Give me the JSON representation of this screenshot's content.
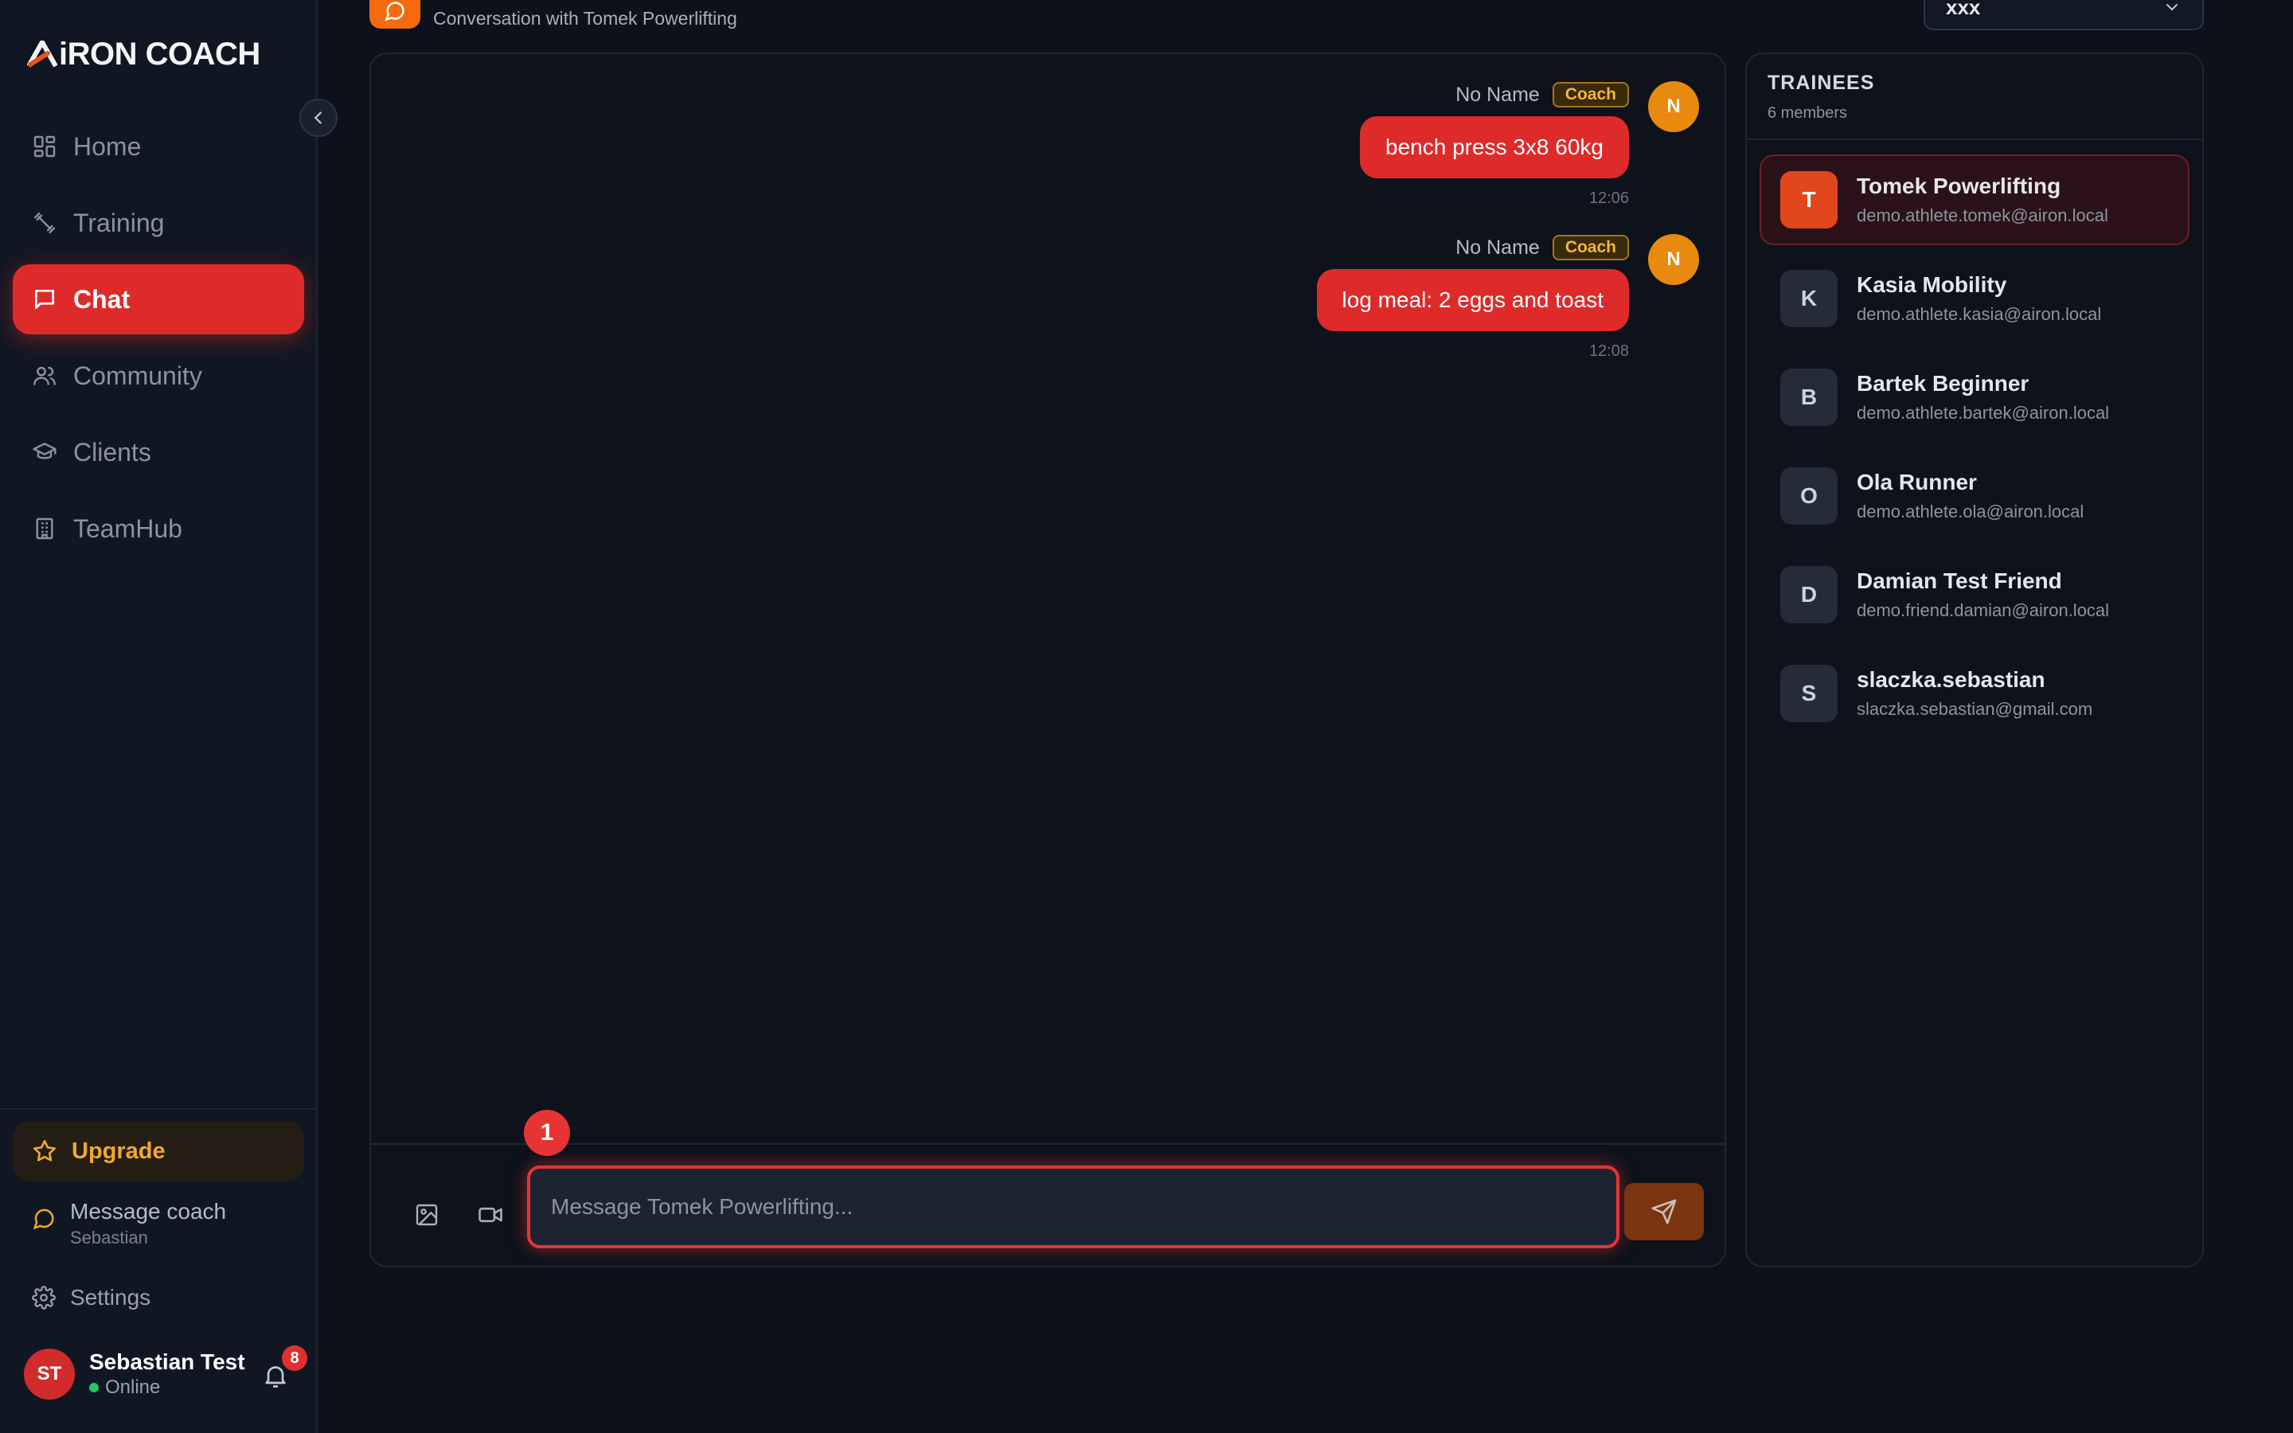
{
  "app": {
    "logo_a": "A",
    "logo_rest": "iRON COACH"
  },
  "sidebar": {
    "items": [
      {
        "label": "Home",
        "icon": "grid-icon"
      },
      {
        "label": "Training",
        "icon": "dumbbell-icon"
      },
      {
        "label": "Chat",
        "icon": "chat-icon",
        "active": true
      },
      {
        "label": "Community",
        "icon": "users-icon"
      },
      {
        "label": "Clients",
        "icon": "graduation-cap-icon"
      },
      {
        "label": "TeamHub",
        "icon": "building-icon"
      }
    ],
    "upgrade_label": "Upgrade",
    "message_coach_label": "Message coach",
    "message_coach_sub": "Sebastian",
    "settings_label": "Settings",
    "user": {
      "initials": "ST",
      "name": "Sebastian Test",
      "status": "Online",
      "notification_count": "8"
    }
  },
  "header": {
    "subtitle": "Conversation with Tomek Powerlifting",
    "select_value": "xxx"
  },
  "chat": {
    "messages": [
      {
        "sender": "No Name",
        "badge": "Coach",
        "avatar": "N",
        "text": "bench press 3x8 60kg",
        "time": "12:06"
      },
      {
        "sender": "No Name",
        "badge": "Coach",
        "avatar": "N",
        "text": "log meal: 2 eggs and toast",
        "time": "12:08"
      }
    ],
    "composer_placeholder": "Message Tomek Powerlifting...",
    "step_badge": "1"
  },
  "trainees": {
    "title": "TRAINEES",
    "count": "6 members",
    "items": [
      {
        "initial": "T",
        "name": "Tomek Powerlifting",
        "email": "demo.athlete.tomek@airon.local",
        "active": true
      },
      {
        "initial": "K",
        "name": "Kasia Mobility",
        "email": "demo.athlete.kasia@airon.local"
      },
      {
        "initial": "B",
        "name": "Bartek Beginner",
        "email": "demo.athlete.bartek@airon.local"
      },
      {
        "initial": "O",
        "name": "Ola Runner",
        "email": "demo.athlete.ola@airon.local"
      },
      {
        "initial": "D",
        "name": "Damian Test Friend",
        "email": "demo.friend.damian@airon.local"
      },
      {
        "initial": "S",
        "name": "slaczka.sebastian",
        "email": "slaczka.sebastian@gmail.com"
      }
    ]
  },
  "colors": {
    "accent": "#df2a2a",
    "coach_badge": "#f4b63a",
    "upgrade": "#f0a92a",
    "online": "#22c55e"
  }
}
